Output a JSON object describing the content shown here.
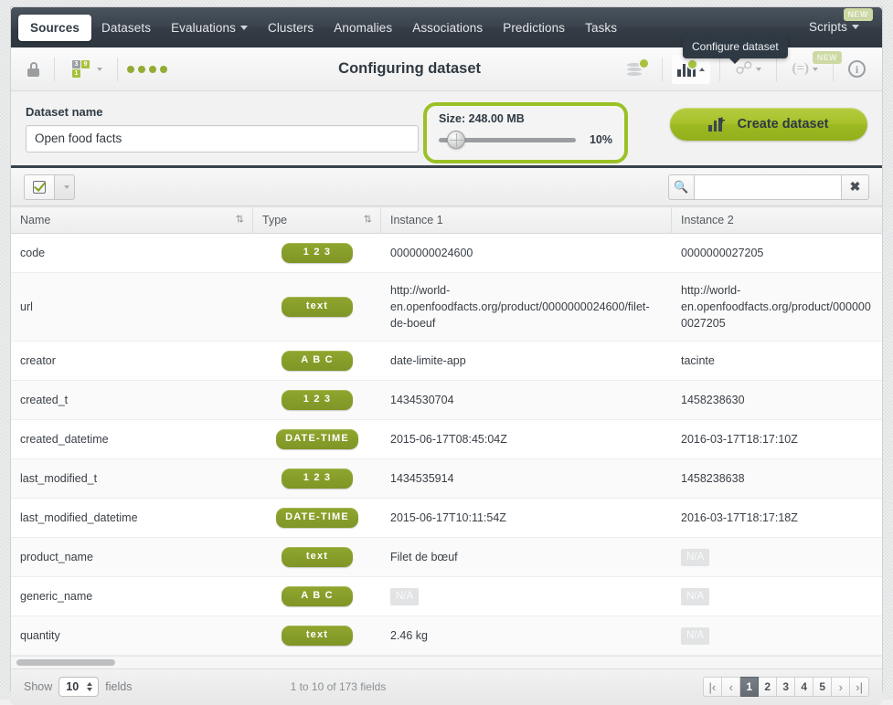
{
  "topnav": {
    "tabs": [
      {
        "label": "Sources",
        "active": true,
        "caret": false
      },
      {
        "label": "Datasets",
        "active": false,
        "caret": false
      },
      {
        "label": "Evaluations",
        "active": false,
        "caret": true
      },
      {
        "label": "Clusters",
        "active": false,
        "caret": false
      },
      {
        "label": "Anomalies",
        "active": false,
        "caret": false
      },
      {
        "label": "Associations",
        "active": false,
        "caret": false
      },
      {
        "label": "Predictions",
        "active": false,
        "caret": false
      },
      {
        "label": "Tasks",
        "active": false,
        "caret": false
      }
    ],
    "right_tab": "Scripts",
    "new_badge": "NEW"
  },
  "tooltip": {
    "text": "Configure dataset"
  },
  "toolbar": {
    "title": "Configuring dataset",
    "lock_icon": "lock-icon",
    "fields_icon": "field-types-icon",
    "status_dots": 4,
    "right_icons": [
      {
        "name": "dataset-settings-icon"
      },
      {
        "name": "dataset-chart-icon"
      },
      {
        "name": "flash-actions-icon"
      },
      {
        "name": "batch-prediction-icon"
      },
      {
        "name": "info-icon"
      }
    ],
    "new_badge": "NEW"
  },
  "form": {
    "dataset_name_label": "Dataset name",
    "dataset_name_value": "Open food facts",
    "dataset_name_placeholder": "Dataset name",
    "size_label": "Size: 248.00 MB",
    "size_percent": "10%",
    "slider_value": 10,
    "create_button": "Create dataset",
    "highlight_color": "#9ac125",
    "accent_color": "#a6c028"
  },
  "filterbar": {
    "select_all_icon": "checkbox-checked-icon",
    "dropdown_icon": "chevron-down-icon",
    "search_icon": "search-icon",
    "search_value": "",
    "search_placeholder": "",
    "clear_icon": "close-icon"
  },
  "table": {
    "columns": [
      {
        "label": "Name",
        "sortable": true
      },
      {
        "label": "Type",
        "sortable": true
      },
      {
        "label": "Instance 1",
        "sortable": false
      },
      {
        "label": "Instance 2",
        "sortable": false
      }
    ],
    "rows": [
      {
        "name": "code",
        "type": "1 2 3",
        "i1": "0000000024600",
        "i2": "0000000027205",
        "i1_na": false,
        "i2_na": false
      },
      {
        "name": "url",
        "type": "text",
        "i1": "http://world-en.openfoodfacts.org/product/0000000024600/filet-de-boeuf",
        "i2": "http://world-en.openfoodfacts.org/product/0000000027205",
        "i1_na": false,
        "i2_na": false
      },
      {
        "name": "creator",
        "type": "A B C",
        "i1": "date-limite-app",
        "i2": "tacinte",
        "i1_na": false,
        "i2_na": false
      },
      {
        "name": "created_t",
        "type": "1 2 3",
        "i1": "1434530704",
        "i2": "1458238630",
        "i1_na": false,
        "i2_na": false
      },
      {
        "name": "created_datetime",
        "type": "DATE-TIME",
        "i1": "2015-06-17T08:45:04Z",
        "i2": "2016-03-17T18:17:10Z",
        "i1_na": false,
        "i2_na": false
      },
      {
        "name": "last_modified_t",
        "type": "1 2 3",
        "i1": "1434535914",
        "i2": "1458238638",
        "i1_na": false,
        "i2_na": false
      },
      {
        "name": "last_modified_datetime",
        "type": "DATE-TIME",
        "i1": "2015-06-17T10:11:54Z",
        "i2": "2016-03-17T18:17:18Z",
        "i1_na": false,
        "i2_na": false
      },
      {
        "name": "product_name",
        "type": "text",
        "i1": "Filet de bœuf",
        "i2": "N/A",
        "i1_na": false,
        "i2_na": true
      },
      {
        "name": "generic_name",
        "type": "A B C",
        "i1": "N/A",
        "i2": "N/A",
        "i1_na": true,
        "i2_na": true
      },
      {
        "name": "quantity",
        "type": "text",
        "i1": "2.46 kg",
        "i2": "N/A",
        "i1_na": false,
        "i2_na": true
      }
    ]
  },
  "footer": {
    "show_label": "Show",
    "show_value": "10",
    "fields_label": "fields",
    "count_text": "1 to 10 of 173 fields",
    "pager": [
      {
        "label": "|‹",
        "type": "nav",
        "name": "first-page"
      },
      {
        "label": "‹",
        "type": "nav",
        "name": "prev-page"
      },
      {
        "label": "1",
        "type": "page",
        "active": true,
        "name": "page-1"
      },
      {
        "label": "2",
        "type": "page",
        "active": false,
        "name": "page-2"
      },
      {
        "label": "3",
        "type": "page",
        "active": false,
        "name": "page-3"
      },
      {
        "label": "4",
        "type": "page",
        "active": false,
        "name": "page-4"
      },
      {
        "label": "5",
        "type": "page",
        "active": false,
        "name": "page-5"
      },
      {
        "label": "›",
        "type": "nav",
        "name": "next-page"
      },
      {
        "label": "›|",
        "type": "nav",
        "name": "last-page"
      }
    ]
  }
}
